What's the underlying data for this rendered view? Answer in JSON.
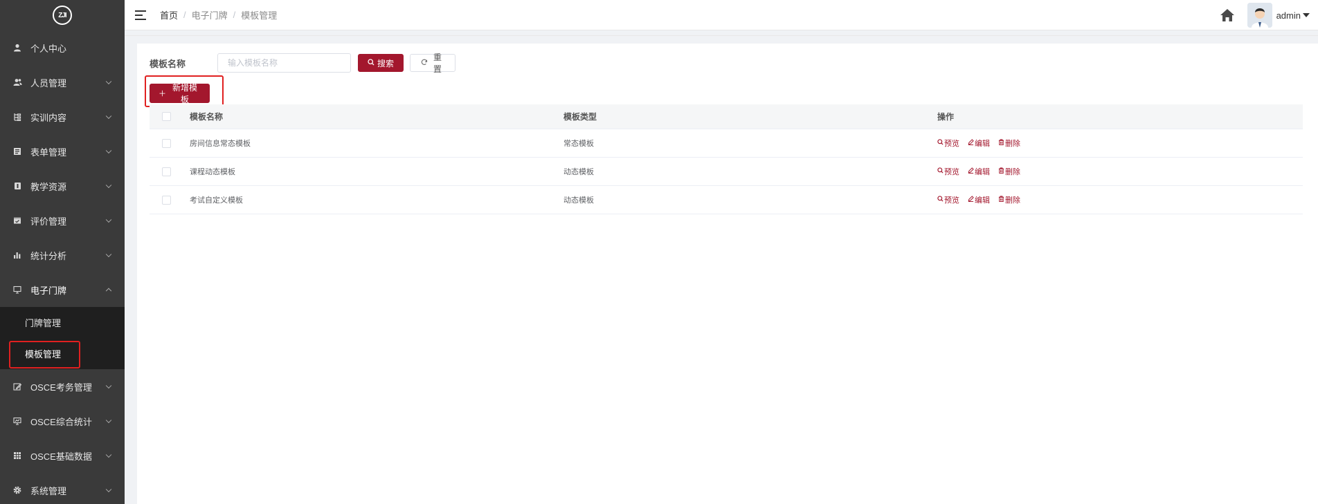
{
  "logo": {
    "text": "ZJI"
  },
  "sidebar": {
    "items": [
      {
        "label": "个人中心",
        "icon": "user-icon",
        "chevron": false
      },
      {
        "label": "人员管理",
        "icon": "users-icon",
        "chevron": true
      },
      {
        "label": "实训内容",
        "icon": "tree-icon",
        "chevron": true
      },
      {
        "label": "表单管理",
        "icon": "form-icon",
        "chevron": true
      },
      {
        "label": "教学资源",
        "icon": "resource-icon",
        "chevron": true
      },
      {
        "label": "评价管理",
        "icon": "evaluate-icon",
        "chevron": true
      },
      {
        "label": "统计分析",
        "icon": "bar-chart-icon",
        "chevron": true
      },
      {
        "label": "电子门牌",
        "icon": "monitor-icon",
        "chevron": true,
        "open": true
      }
    ],
    "submenu": [
      {
        "label": "门牌管理",
        "active": false
      },
      {
        "label": "模板管理",
        "active": true
      }
    ],
    "items_after": [
      {
        "label": "OSCE考务管理",
        "icon": "edit-icon",
        "chevron": true
      },
      {
        "label": "OSCE综合统计",
        "icon": "screen-icon",
        "chevron": true
      },
      {
        "label": "OSCE基础数据",
        "icon": "grid-icon",
        "chevron": true
      },
      {
        "label": "系统管理",
        "icon": "gear-icon",
        "chevron": true
      }
    ]
  },
  "header": {
    "breadcrumb": [
      "首页",
      "电子门牌",
      "模板管理"
    ],
    "username": "admin"
  },
  "search": {
    "label": "模板名称",
    "placeholder": "输入模板名称",
    "search_label": "搜索",
    "reset_label": "重置"
  },
  "toolbar": {
    "add_label": "新增模板"
  },
  "table": {
    "columns": [
      "模板名称",
      "模板类型",
      "操作"
    ],
    "rows": [
      {
        "name": "房间信息常态模板",
        "type": "常态模板"
      },
      {
        "name": "课程动态模板",
        "type": "动态模板"
      },
      {
        "name": "考试自定义模板",
        "type": "动态模板"
      }
    ],
    "actions": {
      "preview": "预览",
      "edit": "编辑",
      "delete": "删除"
    }
  },
  "colors": {
    "sidebar_bg": "#3a3a3a",
    "submenu_bg": "#1f1f1f",
    "primary": "#a3172d",
    "highlight_border": "#e02020"
  }
}
